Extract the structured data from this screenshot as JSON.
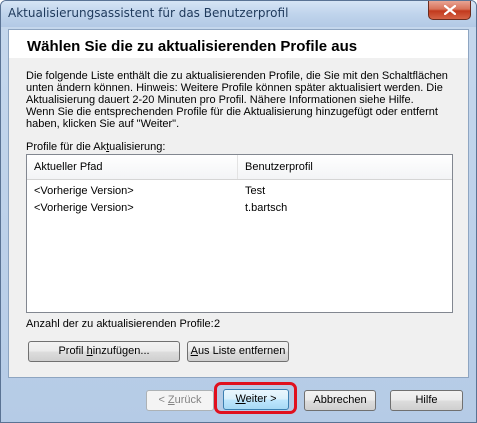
{
  "window": {
    "title": "Aktualisierungsassistent für das Benutzerprofil"
  },
  "header": {
    "title": "Wählen Sie die zu aktualisierenden Profile aus"
  },
  "description": {
    "line1": "Die folgende Liste enthält die zu aktualisierenden Profile, die Sie mit den Schaltflächen",
    "line2": "unten ändern können. Hinweis: Weitere Profile können später aktualisiert werden. Die",
    "line3": "Aktualisierung dauert 2-20 Minuten pro Profil. Nähere Informationen siehe Hilfe.",
    "line4": "Wenn Sie die entsprechenden Profile für die Aktualisierung hinzugefügt oder entfernt",
    "line5": "haben, klicken Sie auf \"Weiter\"."
  },
  "list": {
    "label_pre": "Profile für die Ak",
    "label_acc": "t",
    "label_post": "ualisierung:",
    "columns": [
      "Aktueller Pfad",
      "Benutzerprofil"
    ],
    "rows": [
      {
        "path": "<Vorherige Version>",
        "profile": "Test"
      },
      {
        "path": "<Vorherige Version>",
        "profile": "t.bartsch"
      }
    ]
  },
  "count": {
    "label": "Anzahl der zu aktualisierenden Profile:",
    "value": "2"
  },
  "buttons": {
    "add_pre": "Profil ",
    "add_acc": "h",
    "add_post": "inzufügen...",
    "remove_acc": "A",
    "remove_post": "us Liste entfernen",
    "back_pre": "< ",
    "back_acc": "Z",
    "back_post": "urück",
    "next_acc": "W",
    "next_post": "eiter >",
    "cancel": "Abbrechen",
    "help": "Hilfe"
  },
  "colors": {
    "highlight": "#e0101e",
    "close_button": "#c2391d"
  },
  "icons": {
    "close": "close-icon"
  }
}
